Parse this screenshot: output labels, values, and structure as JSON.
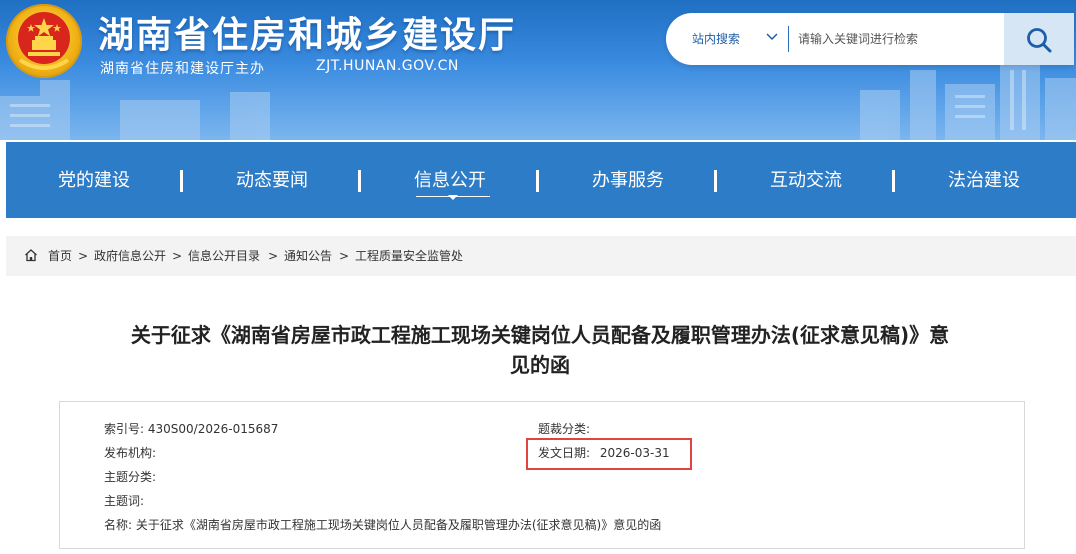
{
  "header": {
    "site_title": "湖南省住房和城乡建设厅",
    "site_subtitle": "湖南省住房和建设厅主办",
    "site_url": "ZJT.HUNAN.GOV.CN",
    "search": {
      "scope": "站内搜索",
      "placeholder": "请输入关键词进行检索"
    }
  },
  "nav": {
    "items": [
      {
        "label": "党的建设"
      },
      {
        "label": "动态要闻"
      },
      {
        "label": "信息公开",
        "active": true
      },
      {
        "label": "办事服务"
      },
      {
        "label": "互动交流"
      },
      {
        "label": "法治建设"
      }
    ]
  },
  "breadcrumb": {
    "items": [
      "首页",
      "政府信息公开",
      "信息公开目录",
      "通知公告",
      "工程质量安全监管处"
    ],
    "separator": ">"
  },
  "article": {
    "title_line1": "关于征求《湖南省房屋市政工程施工现场关键岗位人员配备及履职管理办法(征求意见稿)》意",
    "title_line2": "见的函"
  },
  "meta": {
    "index_label": "索引号:",
    "index_value": "430S00/2026-015687",
    "subject_cat_label": "题裁分类:",
    "publisher_label": "发布机构:",
    "date_label": "发文日期:",
    "date_value": "2026-03-31",
    "topic_label": "主题分类:",
    "keywords_label": "主题词:",
    "name_label": "名称:",
    "name_value": "关于征求《湖南省房屋市政工程施工现场关键岗位人员配备及履职管理办法(征求意见稿)》意见的函"
  },
  "colors": {
    "nav_bg": "#2d7cc7",
    "header_blue": "#1f6fc3",
    "highlight_red": "#e0443d"
  }
}
